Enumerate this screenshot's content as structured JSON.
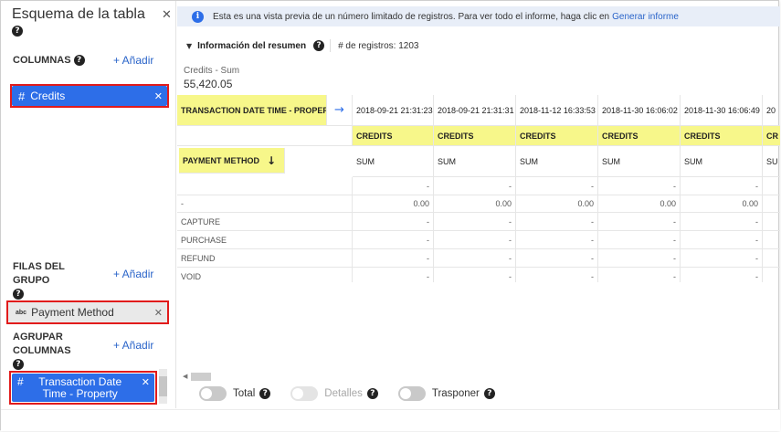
{
  "sidebar": {
    "title": "Esquema de la tabla",
    "columns": {
      "heading": "COLUMNAS",
      "add_label": "+ Añadir",
      "chip": {
        "type_icon": "#",
        "label": "Credits"
      }
    },
    "group_rows": {
      "heading": "FILAS DEL GRUPO",
      "add_label": "+ Añadir",
      "chip": {
        "type_icon": "abc",
        "label": "Payment Method"
      }
    },
    "group_columns": {
      "heading": "AGRUPAR COLUMNAS",
      "add_label": "+ Añadir",
      "chip": {
        "type_icon": "#",
        "label": "Transaction Date Time - Property"
      }
    }
  },
  "info_bar": {
    "message": "Esta es una vista previa de un número limitado de registros. Para ver todo el informe, haga clic en",
    "link": "Generar informe"
  },
  "summary": {
    "label": "Información del resumen",
    "record_count": "# de registros: 1203"
  },
  "metric": {
    "label": "Credits - Sum",
    "value": "55,420.05"
  },
  "pivot": {
    "column_field": "TRANSACTION DATE TIME - PROPERTY",
    "row_field": "PAYMENT METHOD",
    "dates": [
      "2018-09-21 21:31:23",
      "2018-09-21 21:31:31",
      "2018-11-12 16:33:53",
      "2018-11-30 16:06:02",
      "2018-11-30 16:06:49",
      "20"
    ],
    "measure": "CREDITS",
    "measure_partial": "CR",
    "aggregation": "SUM",
    "aggregation_partial": "SU",
    "rows": [
      {
        "label": "",
        "values": [
          "-",
          "-",
          "-",
          "-",
          "-",
          "-"
        ]
      },
      {
        "label": "-",
        "values": [
          "0.00",
          "0.00",
          "0.00",
          "0.00",
          "0.00",
          "-"
        ]
      },
      {
        "label": "CAPTURE",
        "values": [
          "-",
          "-",
          "-",
          "-",
          "-",
          "-"
        ]
      },
      {
        "label": "PURCHASE",
        "values": [
          "-",
          "-",
          "-",
          "-",
          "-",
          "-"
        ]
      },
      {
        "label": "REFUND",
        "values": [
          "-",
          "-",
          "-",
          "-",
          "-",
          "-"
        ]
      },
      {
        "label": "VOID",
        "values": [
          "-",
          "-",
          "-",
          "-",
          "-",
          "-"
        ]
      }
    ]
  },
  "toggles": [
    {
      "label": "Total",
      "enabled": true
    },
    {
      "label": "Detalles",
      "enabled": false
    },
    {
      "label": "Trasponer",
      "enabled": true
    }
  ],
  "colors": {
    "accent": "#2d6ee8",
    "highlight": "#f7f78a",
    "outline": "#e11b1b",
    "link": "#2a64c9"
  }
}
